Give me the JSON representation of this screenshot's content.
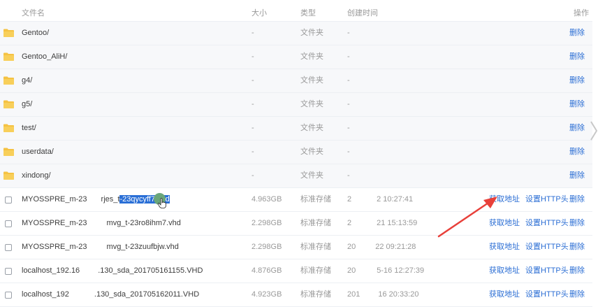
{
  "columns": {
    "name": "文件名",
    "size": "大小",
    "type": "类型",
    "created": "创建时间",
    "actions": "操作"
  },
  "folders": [
    {
      "name": "Gentoo/",
      "size": "-",
      "type": "文件夹",
      "date": "-",
      "delete": "删除"
    },
    {
      "name": "Gentoo_AliH/",
      "size": "-",
      "type": "文件夹",
      "date": "-",
      "delete": "删除"
    },
    {
      "name": "g4/",
      "size": "-",
      "type": "文件夹",
      "date": "-",
      "delete": "删除"
    },
    {
      "name": "g5/",
      "size": "-",
      "type": "文件夹",
      "date": "-",
      "delete": "删除"
    },
    {
      "name": "test/",
      "size": "-",
      "type": "文件夹",
      "date": "-",
      "delete": "删除"
    },
    {
      "name": "userdata/",
      "size": "-",
      "type": "文件夹",
      "date": "-",
      "delete": "删除"
    },
    {
      "name": "xindong/",
      "size": "-",
      "type": "文件夹",
      "date": "-",
      "delete": "删除"
    }
  ],
  "files": [
    {
      "name_a": "MYOSSPRE_m-23",
      "name_b": "rjes_t",
      "name_sel": "-23qycyff7.vhd",
      "size": "4.963GB",
      "type": "标准存储",
      "date_a": "2",
      "date_b": "2 10:27:41",
      "get_url": "获取地址",
      "set_http": "设置HTTP头",
      "delete": "删除"
    },
    {
      "name_a": "MYOSSPRE_m-23",
      "name_b": "mvg_t-23ro8ihm7.vhd",
      "size": "2.298GB",
      "type": "标准存储",
      "date_a": "2",
      "date_b": "21 15:13:59",
      "get_url": "获取地址",
      "set_http": "设置HTTP头",
      "delete": "删除"
    },
    {
      "name_a": "MYOSSPRE_m-23",
      "name_b": "mvg_t-23zuufbjw.vhd",
      "size": "2.298GB",
      "type": "标准存储",
      "date_a": "20",
      "date_b": "22 09:21:28",
      "get_url": "获取地址",
      "set_http": "设置HTTP头",
      "delete": "删除"
    },
    {
      "name_a": "localhost_192.16",
      "name_b": ".130_sda_201705161155.VHD",
      "size": "4.876GB",
      "type": "标准存储",
      "date_a": "20",
      "date_b": "5-16 12:27:39",
      "get_url": "获取地址",
      "set_http": "设置HTTP头",
      "delete": "删除"
    },
    {
      "name_a": "localhost_192",
      "name_b": ".130_sda_201705162011.VHD",
      "size": "4.923GB",
      "type": "标准存储",
      "date_a": "201",
      "date_b": "16 20:33:20",
      "get_url": "获取地址",
      "set_http": "设置HTTP头",
      "delete": "删除"
    }
  ],
  "colors": {
    "link": "#2b6ed4",
    "folder": "#f5c242",
    "annotation_arrow": "#e8403a"
  }
}
